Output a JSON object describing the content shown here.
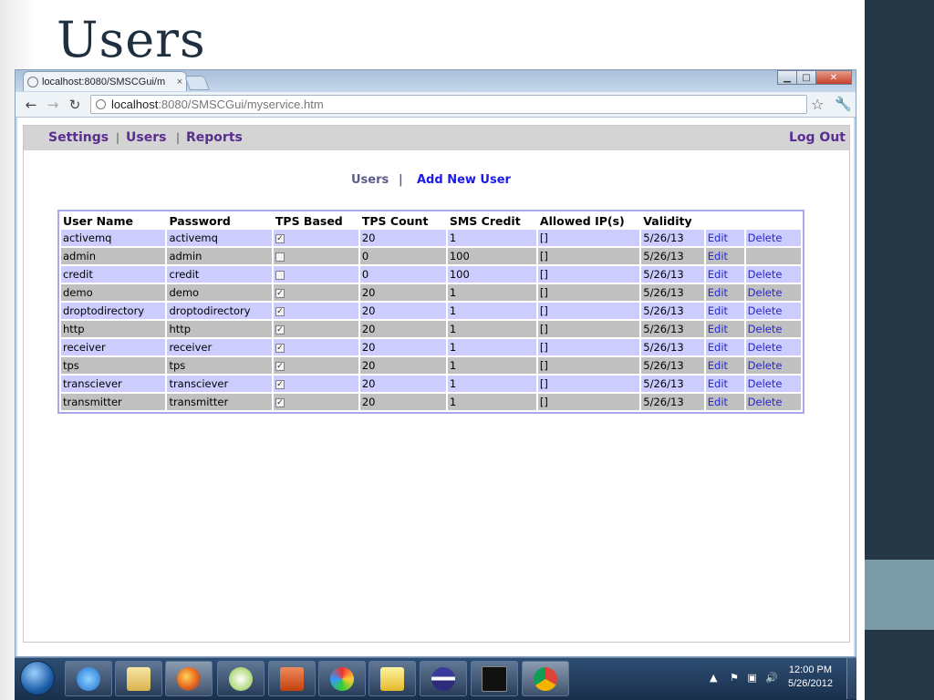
{
  "slide": {
    "title": "Users"
  },
  "browser": {
    "tab_title": "localhost:8080/SMSCGui/m",
    "tab_close": "×",
    "url_host": "localhost",
    "url_path": ":8080/SMSCGui/myservice.htm",
    "window_controls": {
      "minimize": "▁",
      "maximize": "□",
      "close": "✕"
    }
  },
  "nav": {
    "items": [
      "Settings",
      "Users",
      "Reports"
    ],
    "separator": "|",
    "logout": "Log Out"
  },
  "subnav": {
    "current": "Users",
    "separator": "|",
    "add_new": "Add New User"
  },
  "table": {
    "headers": [
      "User Name",
      "Password",
      "TPS Based",
      "TPS Count",
      "SMS Credit",
      "Allowed IP(s)",
      "Validity",
      "",
      ""
    ],
    "rows": [
      {
        "username": "activemq",
        "password": "activemq",
        "tps_based": true,
        "tps_count": "20",
        "sms_credit": "1",
        "allowed_ips": "[]",
        "validity": "5/26/13",
        "edit": "Edit",
        "delete": "Delete"
      },
      {
        "username": "admin",
        "password": "admin",
        "tps_based": false,
        "tps_count": "0",
        "sms_credit": "100",
        "allowed_ips": "[]",
        "validity": "5/26/13",
        "edit": "Edit",
        "delete": ""
      },
      {
        "username": "credit",
        "password": "credit",
        "tps_based": false,
        "tps_count": "0",
        "sms_credit": "100",
        "allowed_ips": "[]",
        "validity": "5/26/13",
        "edit": "Edit",
        "delete": "Delete"
      },
      {
        "username": "demo",
        "password": "demo",
        "tps_based": true,
        "tps_count": "20",
        "sms_credit": "1",
        "allowed_ips": "[]",
        "validity": "5/26/13",
        "edit": "Edit",
        "delete": "Delete"
      },
      {
        "username": "droptodirectory",
        "password": "droptodirectory",
        "tps_based": true,
        "tps_count": "20",
        "sms_credit": "1",
        "allowed_ips": "[]",
        "validity": "5/26/13",
        "edit": "Edit",
        "delete": "Delete"
      },
      {
        "username": "http",
        "password": "http",
        "tps_based": true,
        "tps_count": "20",
        "sms_credit": "1",
        "allowed_ips": "[]",
        "validity": "5/26/13",
        "edit": "Edit",
        "delete": "Delete"
      },
      {
        "username": "receiver",
        "password": "receiver",
        "tps_based": true,
        "tps_count": "20",
        "sms_credit": "1",
        "allowed_ips": "[]",
        "validity": "5/26/13",
        "edit": "Edit",
        "delete": "Delete"
      },
      {
        "username": "tps",
        "password": "tps",
        "tps_based": true,
        "tps_count": "20",
        "sms_credit": "1",
        "allowed_ips": "[]",
        "validity": "5/26/13",
        "edit": "Edit",
        "delete": "Delete"
      },
      {
        "username": "transciever",
        "password": "transciever",
        "tps_based": true,
        "tps_count": "20",
        "sms_credit": "1",
        "allowed_ips": "[]",
        "validity": "5/26/13",
        "edit": "Edit",
        "delete": "Delete"
      },
      {
        "username": "transmitter",
        "password": "transmitter",
        "tps_based": true,
        "tps_count": "20",
        "sms_credit": "1",
        "allowed_ips": "[]",
        "validity": "5/26/13",
        "edit": "Edit",
        "delete": "Delete"
      }
    ]
  },
  "taskbar": {
    "apps": [
      "internet-explorer",
      "file-explorer",
      "firefox",
      "google-talk",
      "powerpoint",
      "paint",
      "notepad-chart",
      "eclipse",
      "command-prompt",
      "chrome"
    ],
    "clock_time": "12:00 PM",
    "clock_date": "5/26/2012"
  },
  "colors": {
    "slide_band": "#253745",
    "slide_accent": "#7a9aa6",
    "nav_link": "#5a2d91",
    "row_odd": "#ccccff",
    "row_even": "#c0c0c0",
    "link_blue": "#2525d0"
  }
}
